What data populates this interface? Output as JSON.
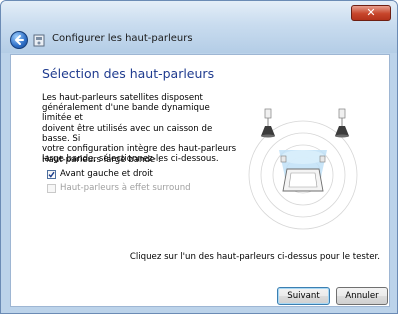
{
  "window": {
    "title": "Configurer les haut-parleurs",
    "close_symbol": "✕"
  },
  "page": {
    "heading": "Sélection des haut-parleurs",
    "description": "Les haut-parleurs satellites disposent\ngénéralement d'une bande dynamique limitée et\ndoivent être utilisés avec un caisson de basse. Si\nvotre configuration intègre des haut-parleurs\nlarge bande, sélectionnez-les ci-dessous.",
    "group_label": "Haut-parleurs large bande :",
    "options": [
      {
        "label": "Avant gauche et droit",
        "checked": true,
        "enabled": true
      },
      {
        "label": "Haut-parleurs à effet surround",
        "checked": false,
        "enabled": false
      }
    ],
    "hint": "Cliquez sur l'un des haut-parleurs ci-dessus pour le tester."
  },
  "buttons": {
    "next": "Suivant",
    "cancel": "Annuler"
  },
  "colors": {
    "heading": "#1f3b8f",
    "frame": "#bcd3ea"
  }
}
